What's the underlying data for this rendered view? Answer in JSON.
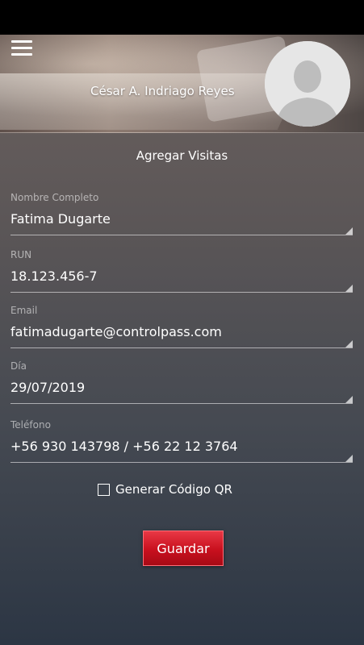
{
  "header": {
    "user_name": "César A. Indriago Reyes"
  },
  "form": {
    "title": "Agregar Visitas",
    "fields": [
      {
        "label": "Nombre Completo",
        "value": "Fatima Dugarte"
      },
      {
        "label": "RUN",
        "value": "18.123.456-7"
      },
      {
        "label": "Email",
        "value": "fatimadugarte@controlpass.com"
      },
      {
        "label": "Día",
        "value": "29/07/2019"
      },
      {
        "label": "Teléfono",
        "value": "+56 930 143798 / +56 22 12 3764"
      }
    ],
    "qr_checkbox_label": "Generar Código QR",
    "save_label": "Guardar"
  },
  "icons": {
    "menu": "hamburger-menu-icon",
    "avatar": "user-silhouette-icon"
  },
  "colors": {
    "accent": "#c8101e"
  }
}
